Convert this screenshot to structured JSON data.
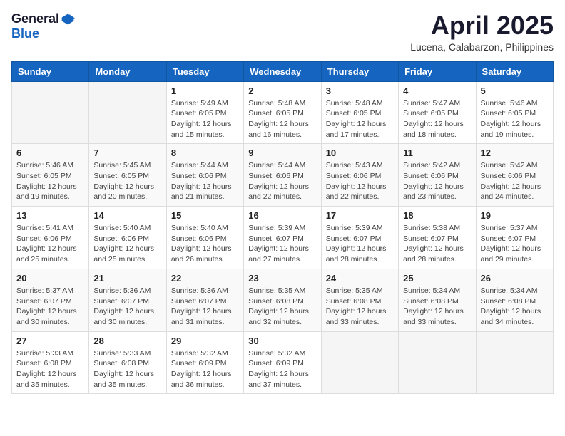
{
  "header": {
    "logo_general": "General",
    "logo_blue": "Blue",
    "month_title": "April 2025",
    "location": "Lucena, Calabarzon, Philippines"
  },
  "weekdays": [
    "Sunday",
    "Monday",
    "Tuesday",
    "Wednesday",
    "Thursday",
    "Friday",
    "Saturday"
  ],
  "weeks": [
    [
      {
        "day": "",
        "info": ""
      },
      {
        "day": "",
        "info": ""
      },
      {
        "day": "1",
        "info": "Sunrise: 5:49 AM\nSunset: 6:05 PM\nDaylight: 12 hours\nand 15 minutes."
      },
      {
        "day": "2",
        "info": "Sunrise: 5:48 AM\nSunset: 6:05 PM\nDaylight: 12 hours\nand 16 minutes."
      },
      {
        "day": "3",
        "info": "Sunrise: 5:48 AM\nSunset: 6:05 PM\nDaylight: 12 hours\nand 17 minutes."
      },
      {
        "day": "4",
        "info": "Sunrise: 5:47 AM\nSunset: 6:05 PM\nDaylight: 12 hours\nand 18 minutes."
      },
      {
        "day": "5",
        "info": "Sunrise: 5:46 AM\nSunset: 6:05 PM\nDaylight: 12 hours\nand 19 minutes."
      }
    ],
    [
      {
        "day": "6",
        "info": "Sunrise: 5:46 AM\nSunset: 6:05 PM\nDaylight: 12 hours\nand 19 minutes."
      },
      {
        "day": "7",
        "info": "Sunrise: 5:45 AM\nSunset: 6:05 PM\nDaylight: 12 hours\nand 20 minutes."
      },
      {
        "day": "8",
        "info": "Sunrise: 5:44 AM\nSunset: 6:06 PM\nDaylight: 12 hours\nand 21 minutes."
      },
      {
        "day": "9",
        "info": "Sunrise: 5:44 AM\nSunset: 6:06 PM\nDaylight: 12 hours\nand 22 minutes."
      },
      {
        "day": "10",
        "info": "Sunrise: 5:43 AM\nSunset: 6:06 PM\nDaylight: 12 hours\nand 22 minutes."
      },
      {
        "day": "11",
        "info": "Sunrise: 5:42 AM\nSunset: 6:06 PM\nDaylight: 12 hours\nand 23 minutes."
      },
      {
        "day": "12",
        "info": "Sunrise: 5:42 AM\nSunset: 6:06 PM\nDaylight: 12 hours\nand 24 minutes."
      }
    ],
    [
      {
        "day": "13",
        "info": "Sunrise: 5:41 AM\nSunset: 6:06 PM\nDaylight: 12 hours\nand 25 minutes."
      },
      {
        "day": "14",
        "info": "Sunrise: 5:40 AM\nSunset: 6:06 PM\nDaylight: 12 hours\nand 25 minutes."
      },
      {
        "day": "15",
        "info": "Sunrise: 5:40 AM\nSunset: 6:06 PM\nDaylight: 12 hours\nand 26 minutes."
      },
      {
        "day": "16",
        "info": "Sunrise: 5:39 AM\nSunset: 6:07 PM\nDaylight: 12 hours\nand 27 minutes."
      },
      {
        "day": "17",
        "info": "Sunrise: 5:39 AM\nSunset: 6:07 PM\nDaylight: 12 hours\nand 28 minutes."
      },
      {
        "day": "18",
        "info": "Sunrise: 5:38 AM\nSunset: 6:07 PM\nDaylight: 12 hours\nand 28 minutes."
      },
      {
        "day": "19",
        "info": "Sunrise: 5:37 AM\nSunset: 6:07 PM\nDaylight: 12 hours\nand 29 minutes."
      }
    ],
    [
      {
        "day": "20",
        "info": "Sunrise: 5:37 AM\nSunset: 6:07 PM\nDaylight: 12 hours\nand 30 minutes."
      },
      {
        "day": "21",
        "info": "Sunrise: 5:36 AM\nSunset: 6:07 PM\nDaylight: 12 hours\nand 30 minutes."
      },
      {
        "day": "22",
        "info": "Sunrise: 5:36 AM\nSunset: 6:07 PM\nDaylight: 12 hours\nand 31 minutes."
      },
      {
        "day": "23",
        "info": "Sunrise: 5:35 AM\nSunset: 6:08 PM\nDaylight: 12 hours\nand 32 minutes."
      },
      {
        "day": "24",
        "info": "Sunrise: 5:35 AM\nSunset: 6:08 PM\nDaylight: 12 hours\nand 33 minutes."
      },
      {
        "day": "25",
        "info": "Sunrise: 5:34 AM\nSunset: 6:08 PM\nDaylight: 12 hours\nand 33 minutes."
      },
      {
        "day": "26",
        "info": "Sunrise: 5:34 AM\nSunset: 6:08 PM\nDaylight: 12 hours\nand 34 minutes."
      }
    ],
    [
      {
        "day": "27",
        "info": "Sunrise: 5:33 AM\nSunset: 6:08 PM\nDaylight: 12 hours\nand 35 minutes."
      },
      {
        "day": "28",
        "info": "Sunrise: 5:33 AM\nSunset: 6:08 PM\nDaylight: 12 hours\nand 35 minutes."
      },
      {
        "day": "29",
        "info": "Sunrise: 5:32 AM\nSunset: 6:09 PM\nDaylight: 12 hours\nand 36 minutes."
      },
      {
        "day": "30",
        "info": "Sunrise: 5:32 AM\nSunset: 6:09 PM\nDaylight: 12 hours\nand 37 minutes."
      },
      {
        "day": "",
        "info": ""
      },
      {
        "day": "",
        "info": ""
      },
      {
        "day": "",
        "info": ""
      }
    ]
  ]
}
